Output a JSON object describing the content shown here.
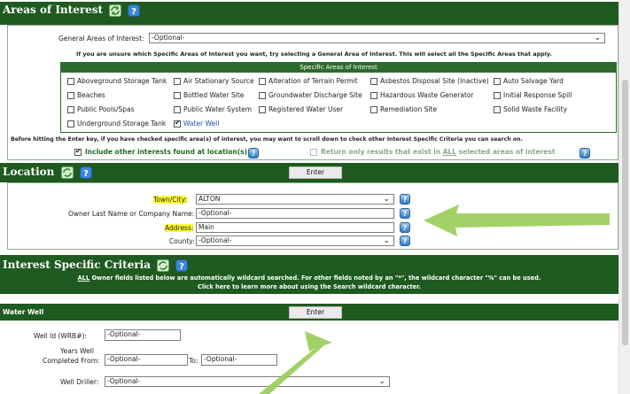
{
  "areas": {
    "title": "Areas of Interest",
    "general_label": "General Areas of Interest:",
    "general_value": "-Optional-",
    "hint": "If you are unsure which Specific Areas of Interest you want, try selecting a General Area of Interest. This will select all the Specific Areas that apply.",
    "specific_title": "Specific Areas of Interest",
    "items": [
      {
        "label": "Aboveground Storage Tank",
        "checked": false
      },
      {
        "label": "Air Stationary Source",
        "checked": false
      },
      {
        "label": "Alteration of Terrain Permit",
        "checked": false
      },
      {
        "label": "Asbestos Disposal Site (Inactive)",
        "checked": false
      },
      {
        "label": "Auto Salvage Yard",
        "checked": false
      },
      {
        "label": "Beaches",
        "checked": false
      },
      {
        "label": "Bottled Water Site",
        "checked": false
      },
      {
        "label": "Groundwater Discharge Site",
        "checked": false
      },
      {
        "label": "Hazardous Waste Generator",
        "checked": false
      },
      {
        "label": "Initial Response Spill",
        "checked": false
      },
      {
        "label": "Public Pools/Spas",
        "checked": false
      },
      {
        "label": "Public Water System",
        "checked": false
      },
      {
        "label": "Registered Water User",
        "checked": false
      },
      {
        "label": "Remediation Site",
        "checked": false
      },
      {
        "label": "Solid Waste Facility",
        "checked": false
      },
      {
        "label": "Underground Storage Tank",
        "checked": false
      },
      {
        "label": "Water Well",
        "checked": true
      }
    ],
    "note": "Before hitting the Enter key, if you have checked specific area(s) of interest, you may want to scroll down to check other Interest Specific Criteria you can search on.",
    "include_label": "Include other interests found at location(s)",
    "return_label_pre": "Return only results that exist in ",
    "return_label_all": "ALL",
    "return_label_post": " selected areas of interest"
  },
  "location": {
    "title": "Location",
    "enter": "Enter",
    "town_label": "Town/City:",
    "town_value": "ALTON",
    "owner_label": "Owner Last Name or Company Name:",
    "owner_value": "-Optional-",
    "address_label": "Address:",
    "address_value": "Main",
    "county_label": "County:",
    "county_value": "-Optional-"
  },
  "criteria": {
    "title": "Interest Specific Criteria",
    "line1_all": "ALL",
    "line1_rest": " Owner fields listed below are automatically wildcard searched. For other fields noted by an \"*\", the wildcard character \"%\" can be used.",
    "line2": "Click here to learn more about using the Search wildcard character."
  },
  "waterwell": {
    "title": "Water Well",
    "enter": "Enter",
    "wellid_label": "Well Id (WRB#):",
    "wellid_value": "-Optional-",
    "years_label_1": "Years Well",
    "years_label_2": "Completed From:",
    "from_value": "-Optional-",
    "to_label": "To:",
    "to_value": "-Optional-",
    "driller_label": "Well Driller:",
    "driller_value": "-Optional-"
  },
  "colors": {
    "header_green": "#1f5a20",
    "arrow_green": "#9acd5a",
    "highlight": "#ffff33"
  },
  "icons": [
    "refresh-icon",
    "help-icon",
    "chevron-down-icon",
    "arrow-pointer-icon"
  ]
}
